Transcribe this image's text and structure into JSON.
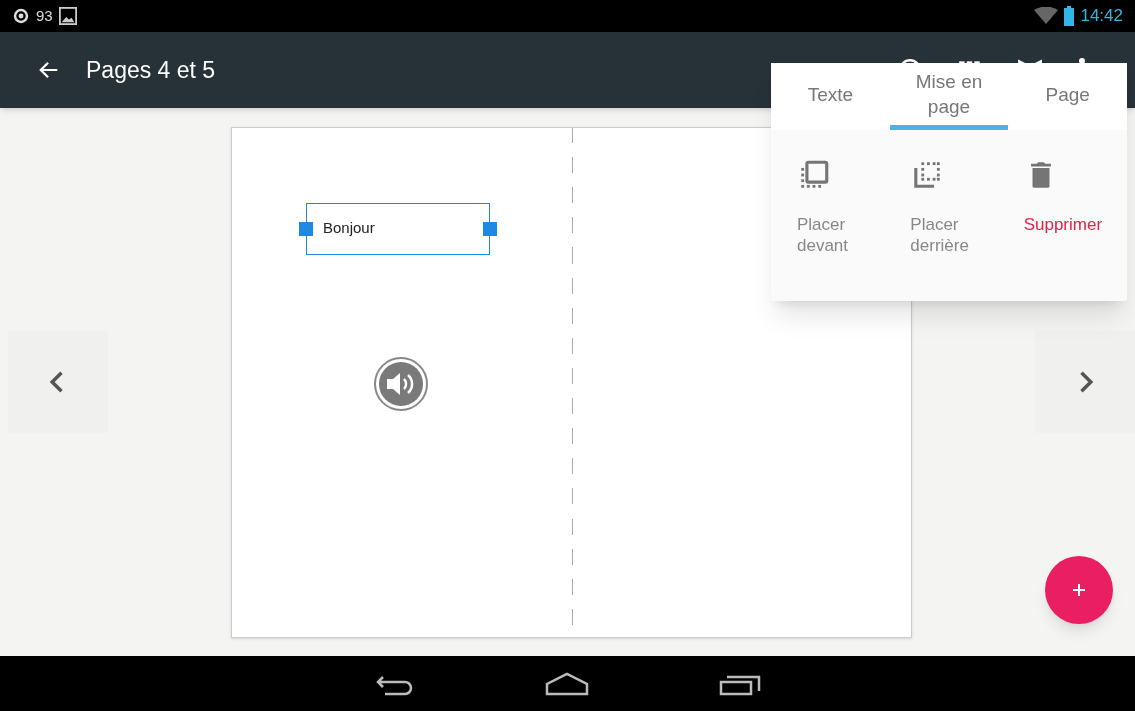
{
  "status_bar": {
    "notification_count": "93",
    "time": "14:42"
  },
  "app_bar": {
    "title": "Pages 4 et 5"
  },
  "canvas": {
    "text_box": {
      "text": "Bonjour",
      "selected": true
    }
  },
  "popup": {
    "tabs": [
      {
        "label": "Texte",
        "selected": false
      },
      {
        "label": "Mise en page",
        "selected": true
      },
      {
        "label": "Page",
        "selected": false
      }
    ],
    "actions": [
      {
        "kind": "front",
        "label": "Placer devant"
      },
      {
        "kind": "back",
        "label": "Placer derrière"
      },
      {
        "kind": "delete",
        "label": "Supprimer"
      }
    ]
  }
}
